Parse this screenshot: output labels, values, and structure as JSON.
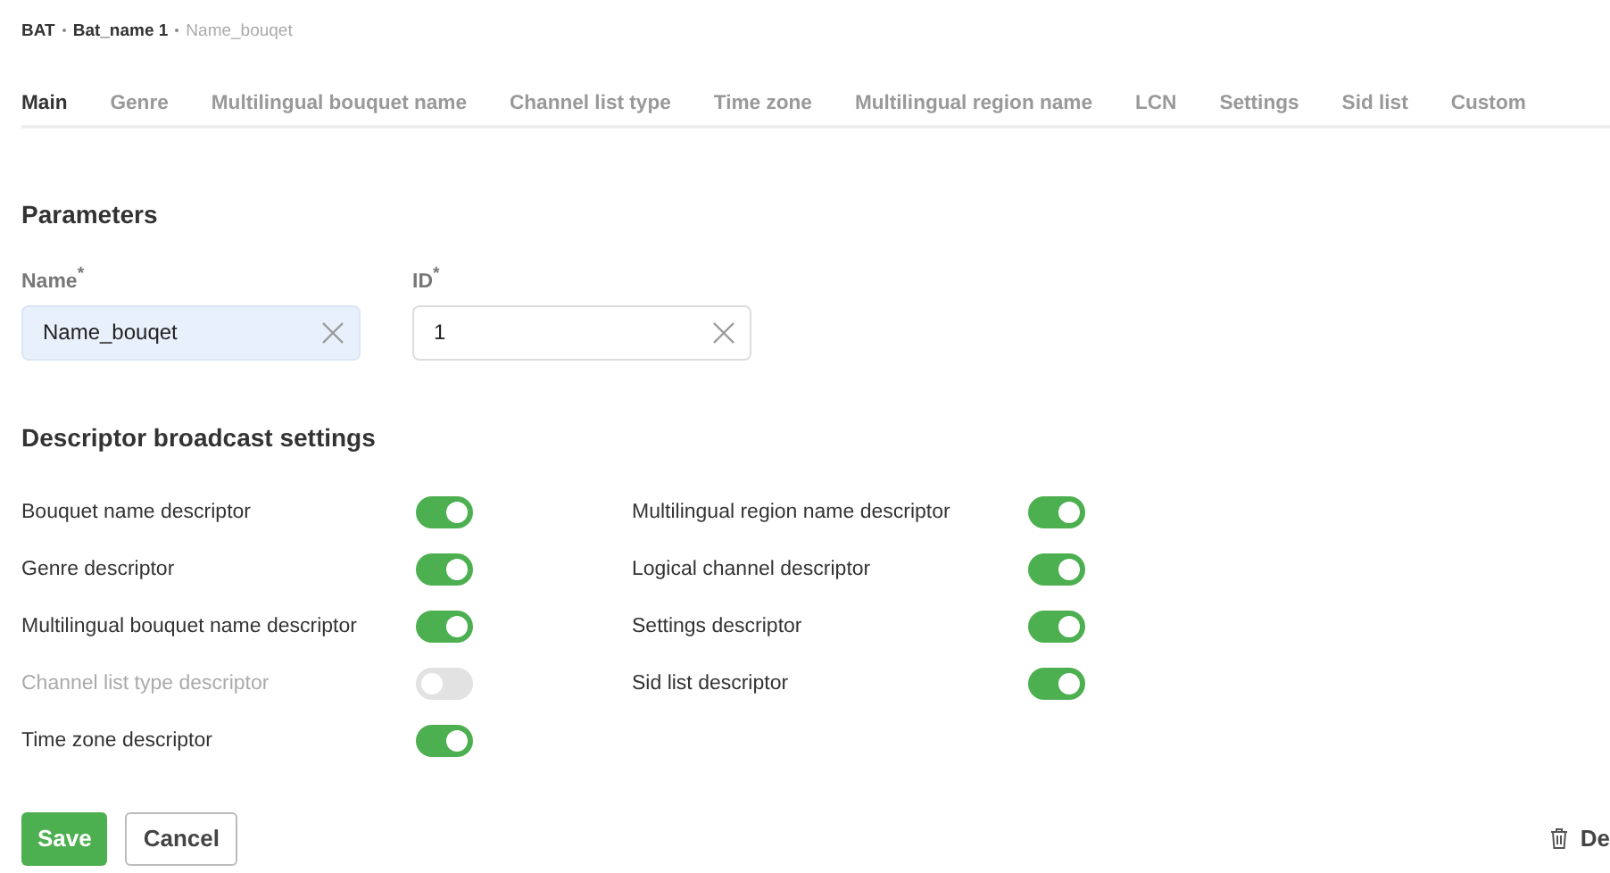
{
  "breadcrumb": [
    {
      "label": "BAT",
      "current": false
    },
    {
      "label": "Bat_name 1",
      "current": false
    },
    {
      "label": "Name_bouqet",
      "current": true
    }
  ],
  "tabs": [
    {
      "label": "Main",
      "selected": true
    },
    {
      "label": "Genre",
      "selected": false
    },
    {
      "label": "Multilingual bouquet name",
      "selected": false
    },
    {
      "label": "Channel list type",
      "selected": false
    },
    {
      "label": "Time zone",
      "selected": false
    },
    {
      "label": "Multilingual region name",
      "selected": false
    },
    {
      "label": "LCN",
      "selected": false
    },
    {
      "label": "Settings",
      "selected": false
    },
    {
      "label": "Sid list",
      "selected": false
    },
    {
      "label": "Custom",
      "selected": false
    }
  ],
  "parameters": {
    "title": "Parameters",
    "fields": [
      {
        "label": "Name$^{*}$",
        "value": "Name_bouqet",
        "focused": true
      },
      {
        "label": "ID$^{*}$",
        "value": "1",
        "focused": false
      }
    ]
  },
  "descriptors": {
    "title": "Descriptor broadcast settings",
    "columns": [
      [
        {
          "label": "Bouquet name descriptor",
          "on": true,
          "disabled": false
        },
        {
          "label": "Genre descriptor",
          "on": true,
          "disabled": false
        },
        {
          "label": "Multilingual bouquet name descriptor",
          "on": true,
          "disabled": false
        },
        {
          "label": "Channel list type descriptor",
          "on": false,
          "disabled": true
        },
        {
          "label": "Time zone descriptor",
          "on": true,
          "disabled": false
        }
      ],
      [
        {
          "label": "Multilingual region name descriptor",
          "on": true,
          "disabled": false
        },
        {
          "label": "Logical channel descriptor",
          "on": true,
          "disabled": false
        },
        {
          "label": "Settings descriptor",
          "on": true,
          "disabled": false
        },
        {
          "label": "Sid list descriptor",
          "on": true,
          "disabled": false
        }
      ]
    ]
  },
  "actions": {
    "save": "Save",
    "cancel": "Cancel",
    "delete": "De"
  }
}
